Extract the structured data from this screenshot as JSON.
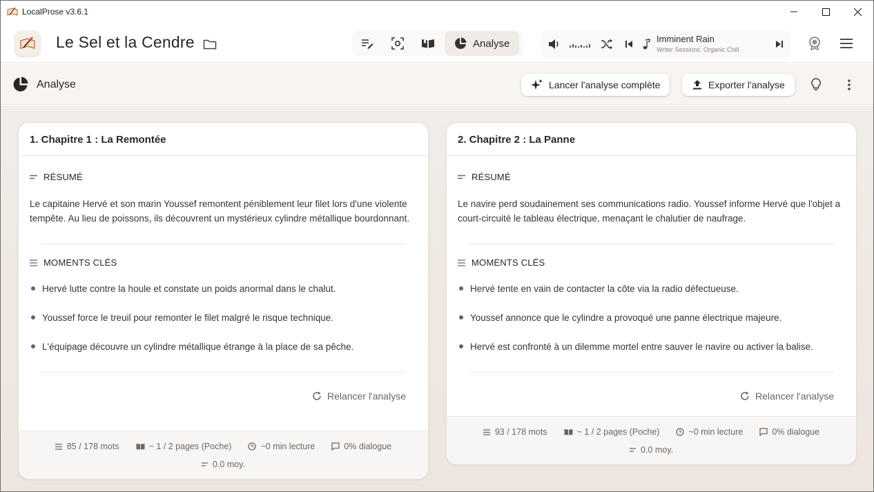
{
  "window": {
    "title": "LocalProse v3.6.1"
  },
  "header": {
    "book_title": "Le Sel et la Cendre",
    "mode_active_label": "Analyse"
  },
  "player": {
    "track_title": "Imminent Rain",
    "track_subtitle": "Writer Sessions: Organic Chill"
  },
  "subheader": {
    "title": "Analyse",
    "run_full_label": "Lancer l'analyse complète",
    "export_label": "Exporter l'analyse"
  },
  "labels": {
    "summary": "RÉSUMÉ",
    "key_moments": "MOMENTS CLÉS",
    "relaunch": "Relancer l'analyse"
  },
  "chapters": [
    {
      "title": "1. Chapitre 1 : La Remontée",
      "summary": "Le capitaine Hervé et son marin Youssef remontent péniblement leur filet lors d'une violente tempête. Au lieu de poissons, ils découvrent un mystérieux cylindre métallique bourdonnant.",
      "moments": [
        "Hervé lutte contre la houle et constate un poids anormal dans le chalut.",
        "Youssef force le treuil pour remonter le filet malgré le risque technique.",
        "L'équipage découvre un cylindre métallique étrange à la place de sa pêche."
      ],
      "stats": {
        "words": "85 / 178 mots",
        "pages": "~ 1 / 2 pages (Poche)",
        "reading": "~0 min lecture",
        "dialogue": "0% dialogue",
        "avg": "0.0 moy."
      }
    },
    {
      "title": "2. Chapitre 2 : La Panne",
      "summary": "Le navire perd soudainement ses communications radio. Youssef informe Hervé que l'objet a court-circuité le tableau électrique, menaçant le chalutier de naufrage.",
      "moments": [
        "Hervé tente en vain de contacter la côte via la radio défectueuse.",
        "Youssef annonce que le cylindre a provoqué une panne électrique majeure.",
        "Hervé est confronté à un dilemme mortel entre sauver le navire ou activer la balise."
      ],
      "stats": {
        "words": "93 / 178 mots",
        "pages": "~ 1 / 2 pages (Poche)",
        "reading": "~0 min lecture",
        "dialogue": "0% dialogue",
        "avg": "0.0 moy."
      }
    }
  ],
  "colors": {
    "text": "#2b2623",
    "muted": "#6d6560",
    "background": "#efe9e2",
    "card": "#ffffff"
  }
}
